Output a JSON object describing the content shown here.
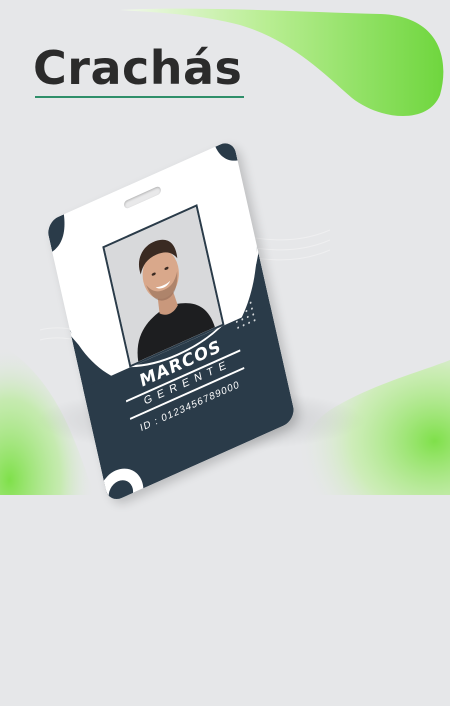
{
  "title": "Crachás",
  "badge": {
    "name": "MARCOS",
    "role": "GERENTE",
    "id_text": "ID : 0123456789000"
  },
  "colors": {
    "background": "#e6e7e9",
    "card_navy": "#2a3b49",
    "accent_green": "#7ddc4e",
    "underline_green": "#2f8f6a"
  },
  "icons": {
    "lanyard_slot": "slot-shape",
    "dot_pattern": "dots-decoration"
  }
}
